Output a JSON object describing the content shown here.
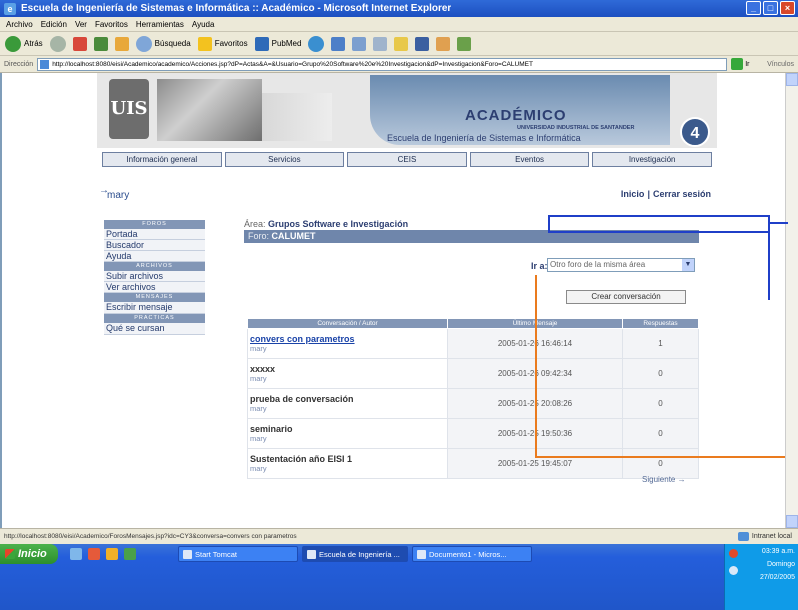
{
  "window": {
    "title": "Escuela de Ingeniería de Sistemas e Informática :: Académico - Microsoft Internet Explorer",
    "buttons": [
      "_",
      "□",
      "×"
    ]
  },
  "menu": [
    "Archivo",
    "Edición",
    "Ver",
    "Favoritos",
    "Herramientas",
    "Ayuda"
  ],
  "toolbar": {
    "back": "Atrás",
    "search": "Búsqueda",
    "favorites": "Favoritos",
    "pubmed": "PubMed"
  },
  "address": {
    "label": "Dirección",
    "url": "http://localhost:8080/eisi/Academico/academico/Acciones.jsp?dP=Actas&A=&Usuario=Grupo%20Software%20e%20Investigacion&dP=Investigacion&Foro=CALUMET",
    "go": "Ir",
    "links": "Vínculos"
  },
  "banner": {
    "logo": "UIS",
    "title": "ACADÉMICO",
    "university": "UNIVERSIDAD INDUSTRIAL DE SANTANDER",
    "school": "Escuela de Ingeniería de Sistemas e Informática"
  },
  "nav": [
    "Información general",
    "Servicios",
    "CEIS",
    "Eventos",
    "Investigación"
  ],
  "user": {
    "arrow": "→",
    "name": "mary",
    "home": "Inicio",
    "separator": "|",
    "logout": "Cerrar sesión"
  },
  "leftmenu": {
    "sections": [
      {
        "head": "FOROS",
        "items": [
          "Portada",
          "Buscador",
          "Ayuda"
        ]
      },
      {
        "head": "ARCHIVOS",
        "items": [
          "Subir archivos",
          "Ver archivos"
        ]
      },
      {
        "head": "MENSAJES",
        "items": [
          "Escribir mensaje"
        ]
      },
      {
        "head": "PRACTICAS",
        "items": [
          "Qué se cursan"
        ]
      }
    ]
  },
  "main": {
    "area_label": "Área:",
    "area_value": "Grupos Software e Investigación",
    "foro_label": "Foro:",
    "foro_value": "CALUMET",
    "ir_label": "Ir a:",
    "ir_select": "Otro foro de la misma área",
    "create_button": "Crear conversación",
    "table": {
      "headers": [
        "Conversación / Autor",
        "Último Mensaje",
        "Respuestas"
      ],
      "rows": [
        {
          "title": "convers con parametros",
          "author": "mary",
          "date": "2005-01-26 16:46:14",
          "responses": "1",
          "link": true
        },
        {
          "title": "xxxxx",
          "author": "mary",
          "date": "2005-01-26 09:42:34",
          "responses": "0",
          "link": false
        },
        {
          "title": "prueba de conversación",
          "author": "mary",
          "date": "2005-01-25 20:08:26",
          "responses": "0",
          "link": false
        },
        {
          "title": "seminario",
          "author": "mary",
          "date": "2005-01-25 19:50:36",
          "responses": "0",
          "link": false
        },
        {
          "title": "Sustentación año EISI 1",
          "author": "mary",
          "date": "2005-01-25 19:45:07",
          "responses": "0",
          "link": false
        }
      ]
    },
    "next": "Siguiente →"
  },
  "status": {
    "url": "http://localhost:8080/eisi/Academico/ForosMensajes.jsp?idc=CY3&conversa=convers con parametros",
    "zone": "Intranet local"
  },
  "taskbar": {
    "start": "Inicio",
    "tasks": [
      "Start Tomcat",
      "Escuela de Ingeniería ...",
      "Documento1 - Micros..."
    ],
    "clock": "03:39 a.m.",
    "day": "Domingo",
    "date": "27/02/2005"
  }
}
